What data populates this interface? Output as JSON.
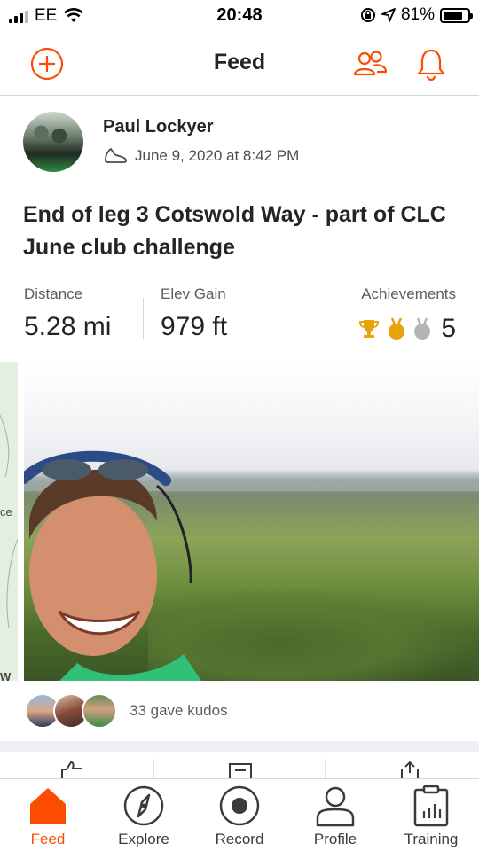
{
  "status_bar": {
    "carrier": "EE",
    "time": "20:48",
    "battery": "81%",
    "battery_level": 0.81
  },
  "header": {
    "title": "Feed"
  },
  "post": {
    "author": "Paul Lockyer",
    "timestamp": "June 9, 2020 at 8:42 PM",
    "title": "End of leg 3 Cotswold Way - part of CLC June club challenge",
    "stats": [
      {
        "label": "Distance",
        "value": "5.28 mi"
      },
      {
        "label": "Elev Gain",
        "value": "979 ft"
      }
    ],
    "achievements": {
      "label": "Achievements",
      "count": "5"
    },
    "map_peek_text": [
      "ce",
      "W"
    ],
    "kudos_text": "33 gave kudos"
  },
  "tabs": [
    {
      "label": "Feed",
      "icon": "home-icon",
      "active": true
    },
    {
      "label": "Explore",
      "icon": "compass-icon",
      "active": false
    },
    {
      "label": "Record",
      "icon": "record-icon",
      "active": false
    },
    {
      "label": "Profile",
      "icon": "person-icon",
      "active": false
    },
    {
      "label": "Training",
      "icon": "clipboard-chart-icon",
      "active": false
    }
  ],
  "colors": {
    "accent": "#fc4c02",
    "text": "#242428",
    "muted": "#5c5c62",
    "gold": "#e8a20c",
    "silver": "#b5b5b5"
  }
}
